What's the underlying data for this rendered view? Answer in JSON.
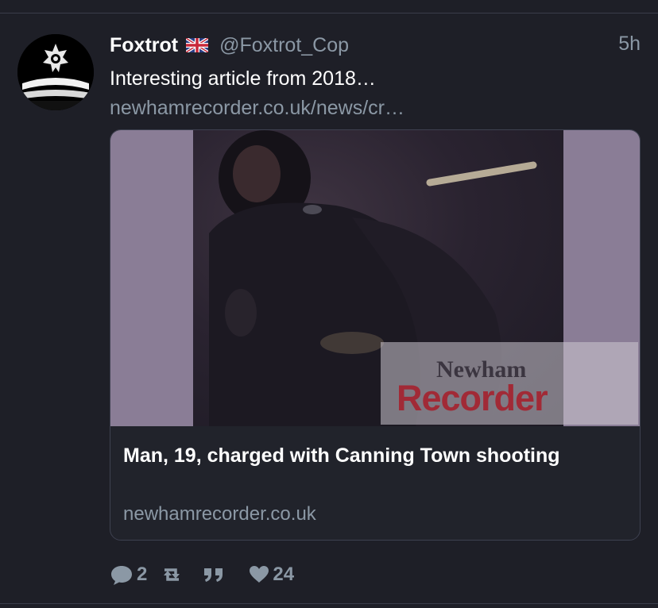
{
  "tweet": {
    "display_name": "Foxtrot",
    "handle": "@Foxtrot_Cop",
    "timestamp": "5h",
    "text": "Interesting article from 2018…",
    "link_text": "newhamrecorder.co.uk/news/cr…",
    "flag_icon": "uk-flag-icon",
    "avatar_icon": "police-badge-avatar"
  },
  "card": {
    "title": "Man, 19, charged with Canning Town shooting",
    "domain": "newhamrecorder.co.uk",
    "watermark": {
      "line1": "Newham",
      "line2": "Recorder"
    },
    "media_description_icon": "cctv-photo"
  },
  "actions": {
    "reply": {
      "icon": "reply-icon",
      "count": "2"
    },
    "retweet": {
      "icon": "retweet-icon",
      "count": ""
    },
    "quote": {
      "icon": "quote-icon",
      "count": ""
    },
    "like": {
      "icon": "heart-icon",
      "count": "24"
    }
  },
  "colors": {
    "background": "#1e1f27",
    "secondary_text": "#8b98a5",
    "primary_text": "#ffffff",
    "card_border": "#3e4150",
    "watermark_red": "#a12a36"
  }
}
